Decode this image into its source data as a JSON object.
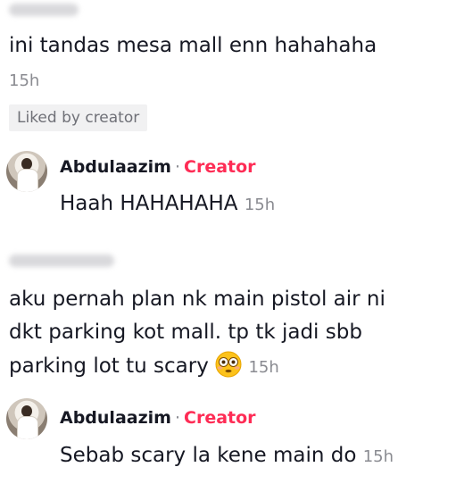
{
  "comments": [
    {
      "text": "ini tandas mesa mall enn hahahaha",
      "time": "15h",
      "badge": "Liked by creator",
      "reply": {
        "author": "Abdulaazim",
        "separator": "·",
        "role": "Creator",
        "text": "Haah HAHAHAHA",
        "time": "15h"
      }
    },
    {
      "lines": [
        "aku pernah plan nk main pistol air ni",
        "dkt parking kot mall. tp tk jadi sbb",
        "parking lot tu scary"
      ],
      "emoji": "flushed-face-emoji",
      "time": "15h",
      "reply": {
        "author": "Abdulaazim",
        "separator": "·",
        "role": "Creator",
        "text": "Sebab scary la kene main do",
        "time": "15h"
      }
    }
  ],
  "colors": {
    "creator": "#fe2c55",
    "timestamp": "#8a8b91",
    "text": "#161823"
  }
}
